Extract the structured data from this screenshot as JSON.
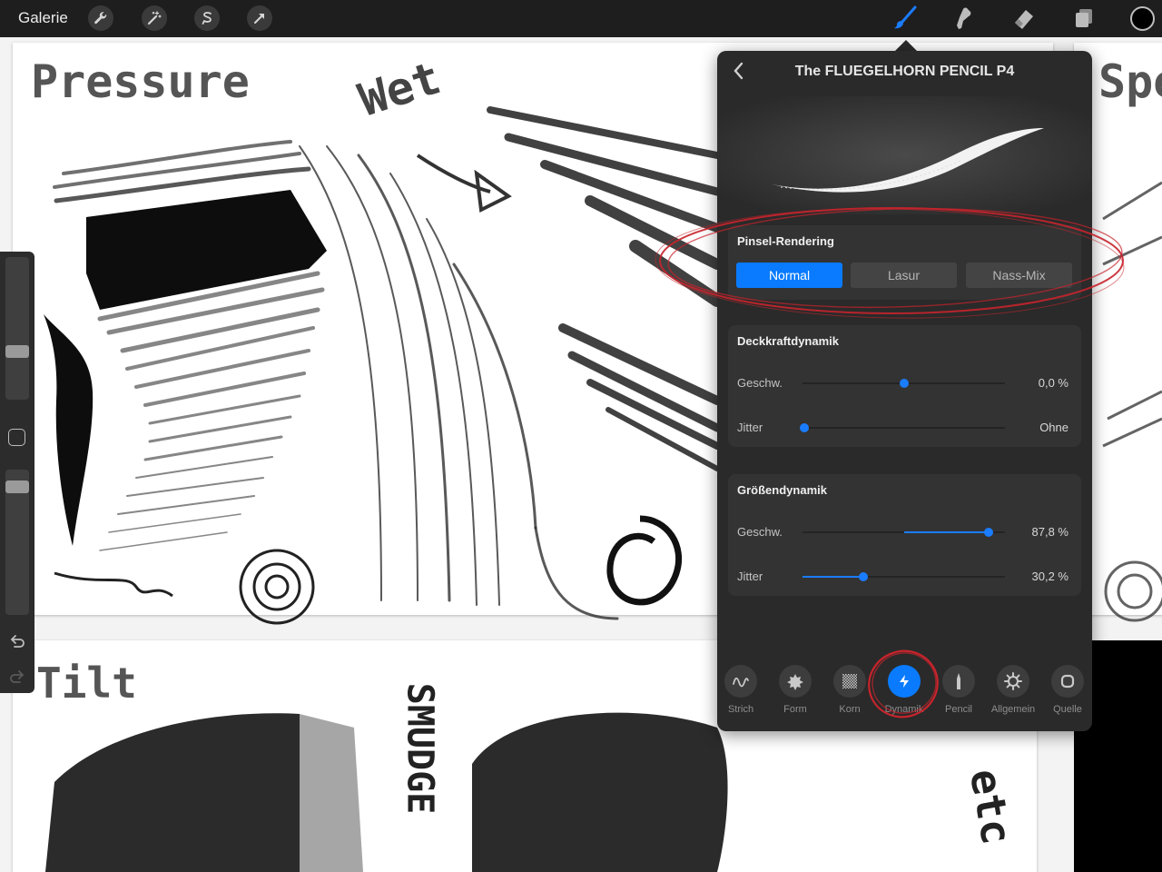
{
  "topbar": {
    "gallery_label": "Galerie",
    "left_tools": [
      "wrench-icon",
      "magic-wand-icon",
      "selection-icon",
      "transform-arrow-icon"
    ],
    "right_tools": [
      "brush-icon",
      "smudge-icon",
      "eraser-icon",
      "layers-icon"
    ],
    "active_tool": "brush-icon",
    "current_color": "#000000"
  },
  "canvas": {
    "titles": {
      "pressure": "Pressure",
      "wet": "Wet",
      "tilt": "Tilt",
      "smudge": "SMUDGE",
      "speed": "Spe",
      "etc": "etc"
    }
  },
  "sidebar": {
    "size_slider_level": 0.32,
    "opacity_slider_level": 0.92,
    "icons": [
      "modify-button",
      "undo-icon",
      "redo-icon"
    ]
  },
  "panel": {
    "title": "The FLUEGELHORN PENCIL P4",
    "rendering": {
      "title": "Pinsel-Rendering",
      "options": [
        "Normal",
        "Lasur",
        "Nass-Mix"
      ],
      "selected": "Normal"
    },
    "opacity_dynamics": {
      "title": "Deckkraftdynamik",
      "rows": [
        {
          "label": "Geschw.",
          "value": "0,0 %",
          "level": 0.5
        },
        {
          "label": "Jitter",
          "value": "Ohne",
          "level": 0.01
        }
      ]
    },
    "size_dynamics": {
      "title": "Größendynamik",
      "rows": [
        {
          "label": "Geschw.",
          "value": "87,8 %",
          "level": 0.92,
          "fill_from": 0.5
        },
        {
          "label": "Jitter",
          "value": "30,2 %",
          "level": 0.3,
          "fill_from": 0.0
        }
      ]
    },
    "tabs": [
      {
        "label": "Strich",
        "icon": "stroke-icon"
      },
      {
        "label": "Form",
        "icon": "shape-icon"
      },
      {
        "label": "Korn",
        "icon": "grain-icon"
      },
      {
        "label": "Dynamik",
        "icon": "lightning-icon"
      },
      {
        "label": "Pencil",
        "icon": "pencil-icon"
      },
      {
        "label": "Allgemein",
        "icon": "gear-icon"
      },
      {
        "label": "Quelle",
        "icon": "source-icon"
      }
    ],
    "active_tab": "Dynamik",
    "accent_color": "#0a7bff",
    "annotation_color": "#c8242c"
  }
}
